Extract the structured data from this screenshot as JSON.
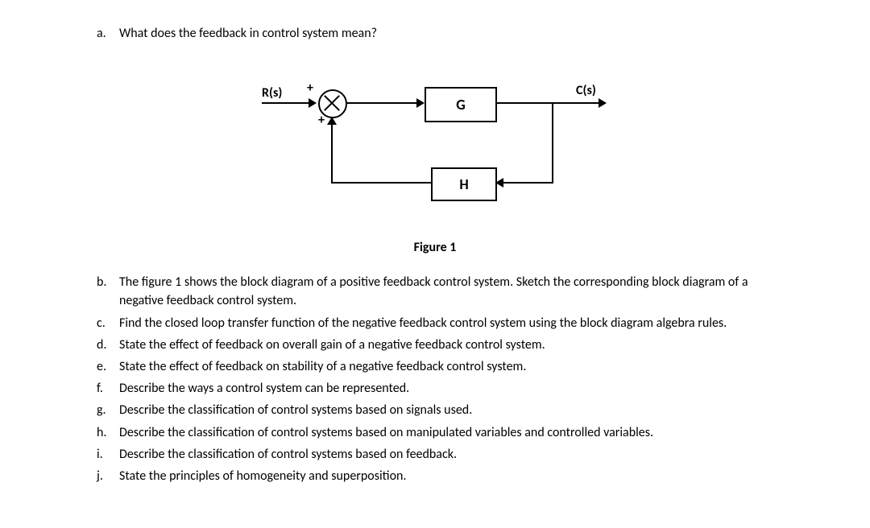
{
  "questions": {
    "a": {
      "marker": "a.",
      "text": "What does the feedback in control system mean?"
    },
    "b": {
      "marker": "b.",
      "text": "The figure 1 shows the block diagram of a positive feedback control system. Sketch the corresponding block diagram of a negative feedback control system."
    },
    "c": {
      "marker": "c.",
      "text": "Find the closed loop transfer function of the negative feedback control system using the block diagram algebra rules."
    },
    "d": {
      "marker": "d.",
      "text": "State the effect of feedback on overall gain of a negative feedback control system."
    },
    "e": {
      "marker": "e.",
      "text": "State the effect of feedback on stability of a negative feedback control system."
    },
    "f": {
      "marker": "f.",
      "text": "Describe the ways a control system can be represented."
    },
    "g": {
      "marker": "g.",
      "text": "Describe the classification of control systems based on signals used."
    },
    "h": {
      "marker": "h.",
      "text": "Describe the classification of control systems based on manipulated variables and controlled variables."
    },
    "i": {
      "marker": "i.",
      "text": "Describe the classification of control systems based on feedback."
    },
    "j": {
      "marker": "j.",
      "text": "State the principles of homogeneity and superposition."
    }
  },
  "diagram": {
    "input_label": "R(s)",
    "output_label": "C(s)",
    "block_g": "G",
    "block_h": "H",
    "sign_top": "+",
    "sign_bottom": "+",
    "caption": "Figure 1"
  }
}
